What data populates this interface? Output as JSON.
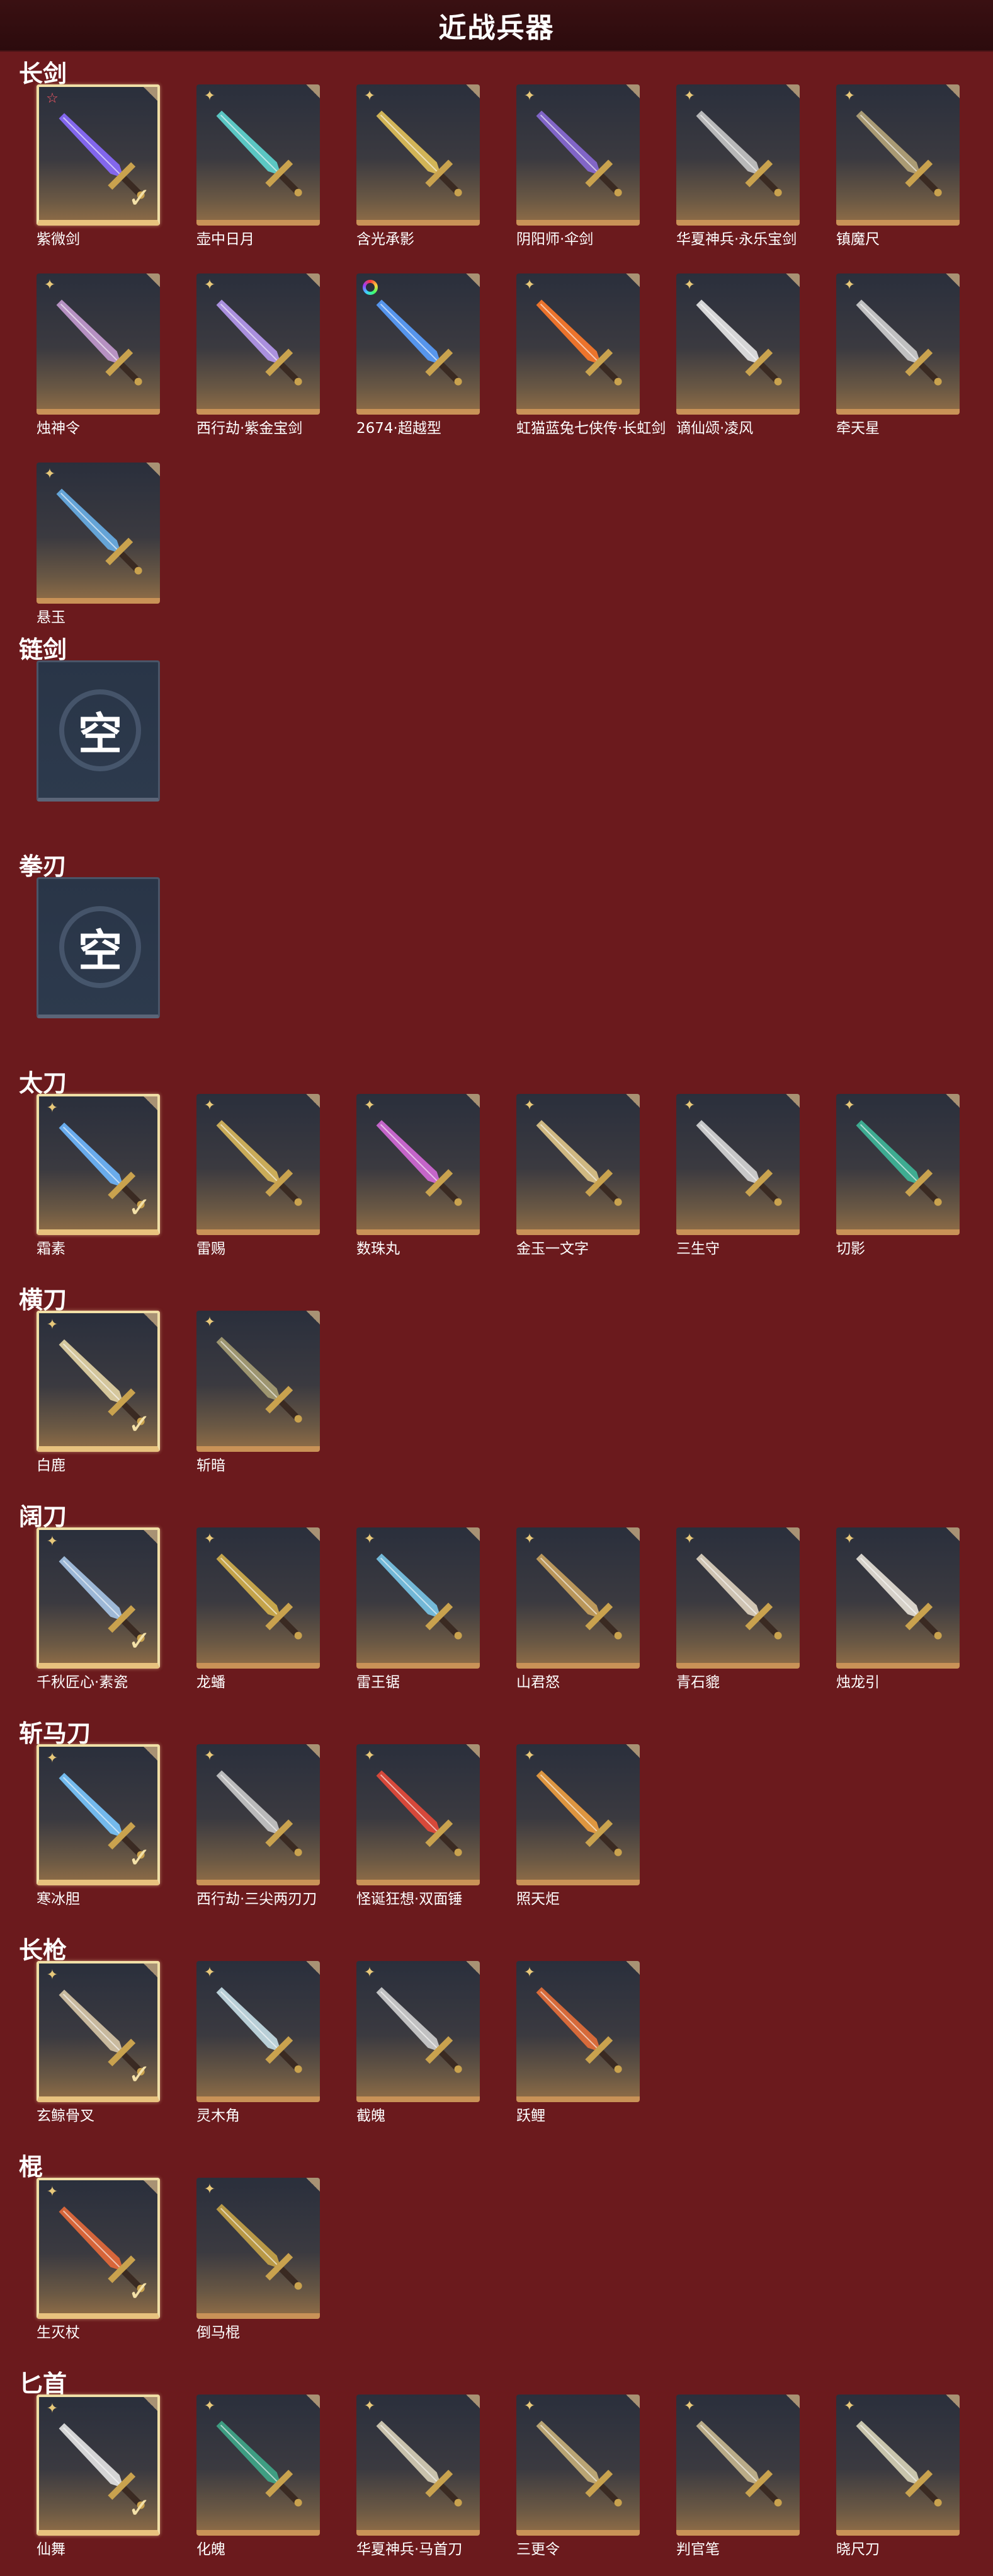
{
  "page": {
    "title": "近战兵器"
  },
  "icons": {
    "flower": "✦",
    "star": "☆",
    "check": "✓"
  },
  "sections": [
    {
      "title": "长剑",
      "items": [
        {
          "name": "紫微剑",
          "equipped": true,
          "badge": "star",
          "color": "#8b6cff"
        },
        {
          "name": "壶中日月",
          "badge": "flower",
          "color": "#5fd6d1"
        },
        {
          "name": "含光承影",
          "badge": "flower",
          "color": "#e2c25a"
        },
        {
          "name": "阴阳师·伞剑",
          "badge": "flower",
          "color": "#8a6ad6"
        },
        {
          "name": "华夏神兵·永乐宝剑",
          "badge": "flower",
          "color": "#c7c7c7"
        },
        {
          "name": "镇魔尺",
          "badge": "flower",
          "color": "#b6a57a"
        },
        {
          "name": "烛神令",
          "badge": "flower",
          "color": "#c49bd0"
        },
        {
          "name": "西行劫·紫金宝剑",
          "badge": "flower",
          "color": "#b79af0"
        },
        {
          "name": "2674·超越型",
          "badge": "ring",
          "color": "#5aa0ff"
        },
        {
          "name": "虹猫蓝兔七侠传·长虹剑",
          "badge": "flower",
          "color": "#ff7a2a"
        },
        {
          "name": "谪仙颂·凌风",
          "badge": "flower",
          "color": "#e8e8e8"
        },
        {
          "name": "牵天星",
          "badge": "flower",
          "color": "#cfcfcf"
        },
        {
          "name": "悬玉",
          "badge": "flower",
          "color": "#6ab0e8"
        }
      ]
    },
    {
      "title": "链剑",
      "items": [
        {
          "name": "",
          "empty": true,
          "empty_char": "空"
        }
      ]
    },
    {
      "title": "拳刃",
      "items": [
        {
          "name": "",
          "empty": true,
          "empty_char": "空"
        }
      ]
    },
    {
      "title": "太刀",
      "items": [
        {
          "name": "霜素",
          "equipped": true,
          "badge": "flower",
          "color": "#6fb8ff"
        },
        {
          "name": "雷赐",
          "badge": "flower",
          "color": "#d9b85c"
        },
        {
          "name": "数珠丸",
          "badge": "flower",
          "color": "#d46ad8"
        },
        {
          "name": "金玉一文字",
          "badge": "flower",
          "color": "#e0c68a"
        },
        {
          "name": "三生守",
          "badge": "flower",
          "color": "#d7d7d7"
        },
        {
          "name": "切影",
          "badge": "flower",
          "color": "#3fb89a"
        }
      ]
    },
    {
      "title": "横刀",
      "items": [
        {
          "name": "白鹿",
          "equipped": true,
          "badge": "flower",
          "color": "#e6d6a6"
        },
        {
          "name": "斩暗",
          "badge": "flower",
          "color": "#a8a076"
        }
      ]
    },
    {
      "title": "阔刀",
      "items": [
        {
          "name": "千秋匠心·素瓷",
          "equipped": true,
          "badge": "flower",
          "color": "#a8c6e8"
        },
        {
          "name": "龙蟠",
          "badge": "flower",
          "color": "#d4b04c"
        },
        {
          "name": "雷王锯",
          "badge": "flower",
          "color": "#7ac6e8"
        },
        {
          "name": "山君怒",
          "badge": "flower",
          "color": "#c9a25e"
        },
        {
          "name": "青石貔",
          "badge": "flower",
          "color": "#e0d4c0"
        },
        {
          "name": "烛龙引",
          "badge": "flower",
          "color": "#e8e2d8"
        }
      ]
    },
    {
      "title": "斩马刀",
      "items": [
        {
          "name": "寒冰胆",
          "equipped": true,
          "badge": "flower",
          "color": "#7ac8ff"
        },
        {
          "name": "西行劫·三尖两刃刀",
          "badge": "flower",
          "color": "#c9c9c9"
        },
        {
          "name": "怪诞狂想·双面锤",
          "badge": "flower",
          "color": "#e84a3a"
        },
        {
          "name": "照天炬",
          "badge": "flower",
          "color": "#f0a040"
        }
      ]
    },
    {
      "title": "长枪",
      "items": [
        {
          "name": "玄鲸骨叉",
          "equipped": true,
          "badge": "flower",
          "color": "#d8c8a8"
        },
        {
          "name": "灵木角",
          "badge": "flower",
          "color": "#c8e0e8"
        },
        {
          "name": "截魄",
          "badge": "flower",
          "color": "#d0d0d0"
        },
        {
          "name": "跃鲤",
          "badge": "flower",
          "color": "#e8703a"
        }
      ]
    },
    {
      "title": "棍",
      "items": [
        {
          "name": "生灭杖",
          "equipped": true,
          "badge": "flower",
          "color": "#e86a3a"
        },
        {
          "name": "倒马棍",
          "badge": "flower",
          "color": "#c8a448"
        }
      ]
    },
    {
      "title": "匕首",
      "items": [
        {
          "name": "仙舞",
          "equipped": true,
          "badge": "flower",
          "color": "#e6e6e6"
        },
        {
          "name": "化魄",
          "badge": "flower",
          "color": "#3fa88a"
        },
        {
          "name": "华夏神兵·马首刀",
          "badge": "flower",
          "color": "#d8d0b8"
        },
        {
          "name": "三更令",
          "badge": "flower",
          "color": "#c8b07a"
        },
        {
          "name": "判官笔",
          "badge": "flower",
          "color": "#c8b890"
        },
        {
          "name": "晓尺刀",
          "badge": "flower",
          "color": "#d8d4b8"
        }
      ]
    }
  ]
}
